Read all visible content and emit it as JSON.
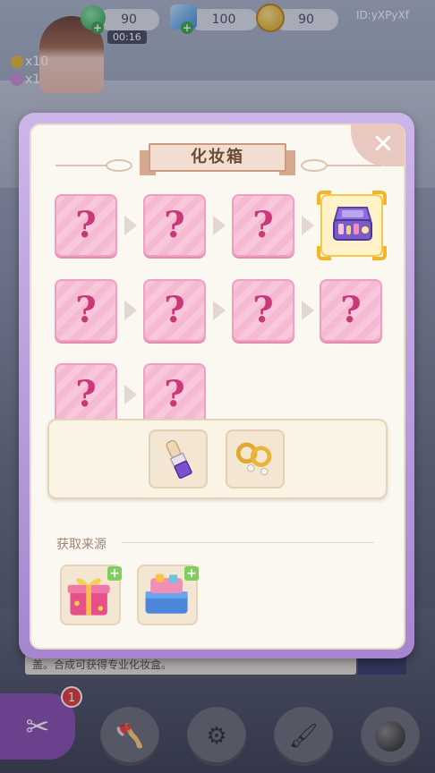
{
  "hud": {
    "gems": "90",
    "diamonds": "100",
    "coins": "90",
    "timer": "00:16",
    "user_id": "ID:yXPyXf",
    "counter_a": "x10",
    "counter_b": "x1"
  },
  "background_hint": "盖。合成可获得专业化妆盒。",
  "tools": {
    "badge_count": "1"
  },
  "dialog": {
    "title": "化妆箱",
    "close_label": "✕",
    "unknown_symbol": "?",
    "chain_rows": [
      [
        "?",
        "?",
        "?",
        "makeup-case"
      ],
      [
        "?",
        "?",
        "?",
        "?"
      ],
      [
        "?",
        "?"
      ]
    ],
    "source_label": "获取来源"
  },
  "colors": {
    "dialog_frame": "#b79ade",
    "slot_pink": "#f9c7dc",
    "question_mark": "#c9397a",
    "title_ribbon": "#f3ddd0",
    "plus_green": "#7ecf5e"
  }
}
